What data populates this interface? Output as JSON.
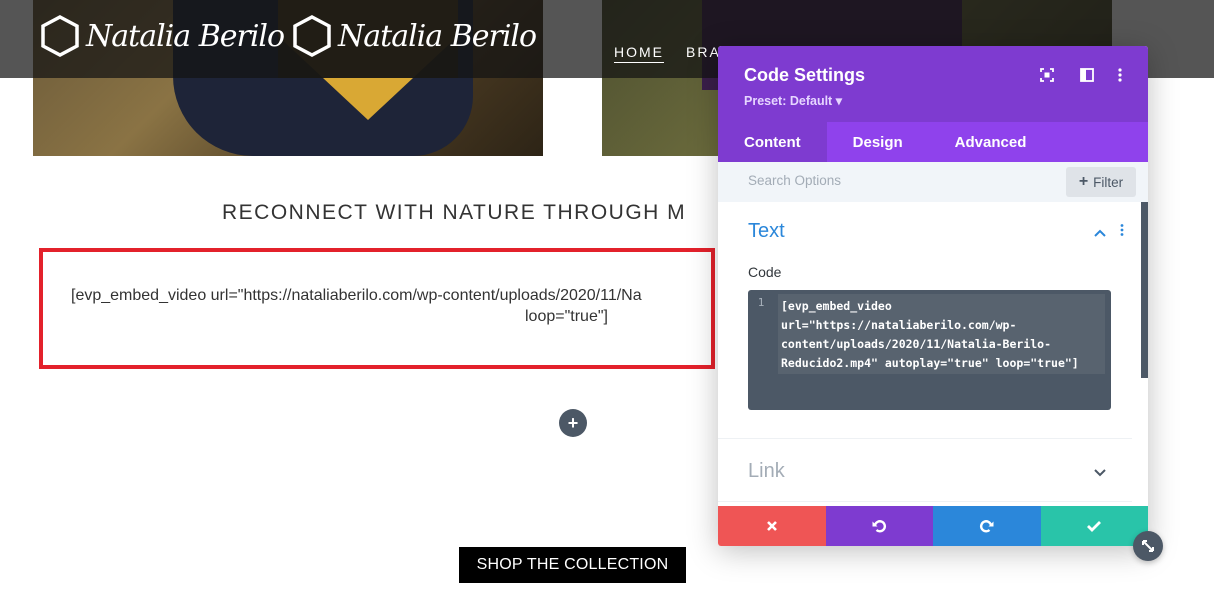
{
  "site": {
    "logo_text": "Natalia Berilo",
    "nav": {
      "home": "HOME",
      "brand_partial": "BRA"
    },
    "section_heading": "RECONNECT WITH NATURE THROUGH M",
    "code_module": {
      "line1": "[evp_embed_video url=\"https://nataliaberilo.com/wp-content/uploads/2020/11/Na",
      "line2": "loop=\"true\"]"
    },
    "add_button": "+",
    "shop_button": "SHOP THE COLLECTION"
  },
  "modal": {
    "title": "Code Settings",
    "preset": "Preset: Default ▾",
    "header_icons": [
      "fullscreen-icon",
      "split-view-icon",
      "more-vertical-icon"
    ],
    "tabs": [
      {
        "label": "Content",
        "active": true
      },
      {
        "label": "Design",
        "active": false
      },
      {
        "label": "Advanced",
        "active": false
      }
    ],
    "search_placeholder": "Search Options",
    "filter_label": "Filter",
    "groups": {
      "text": {
        "title": "Text",
        "expanded": true
      },
      "link": {
        "title": "Link",
        "expanded": false
      }
    },
    "code_field": {
      "label": "Code",
      "line_number": "1",
      "value": "[evp_embed_video url=\"https://nataliaberilo.com/wp-content/uploads/2020/11/Natalia-Berilo-Reducido2.mp4\" autoplay=\"true\" loop=\"true\"]"
    },
    "footer_buttons": [
      "cancel",
      "undo",
      "redo",
      "save"
    ]
  },
  "colors": {
    "modal_header": "#7e3bd0",
    "tabs_bg": "#8f42ec",
    "accent_blue": "#2b87da",
    "cancel": "#ef5555",
    "save": "#29c4a9",
    "highlight_border": "#e3212b"
  }
}
